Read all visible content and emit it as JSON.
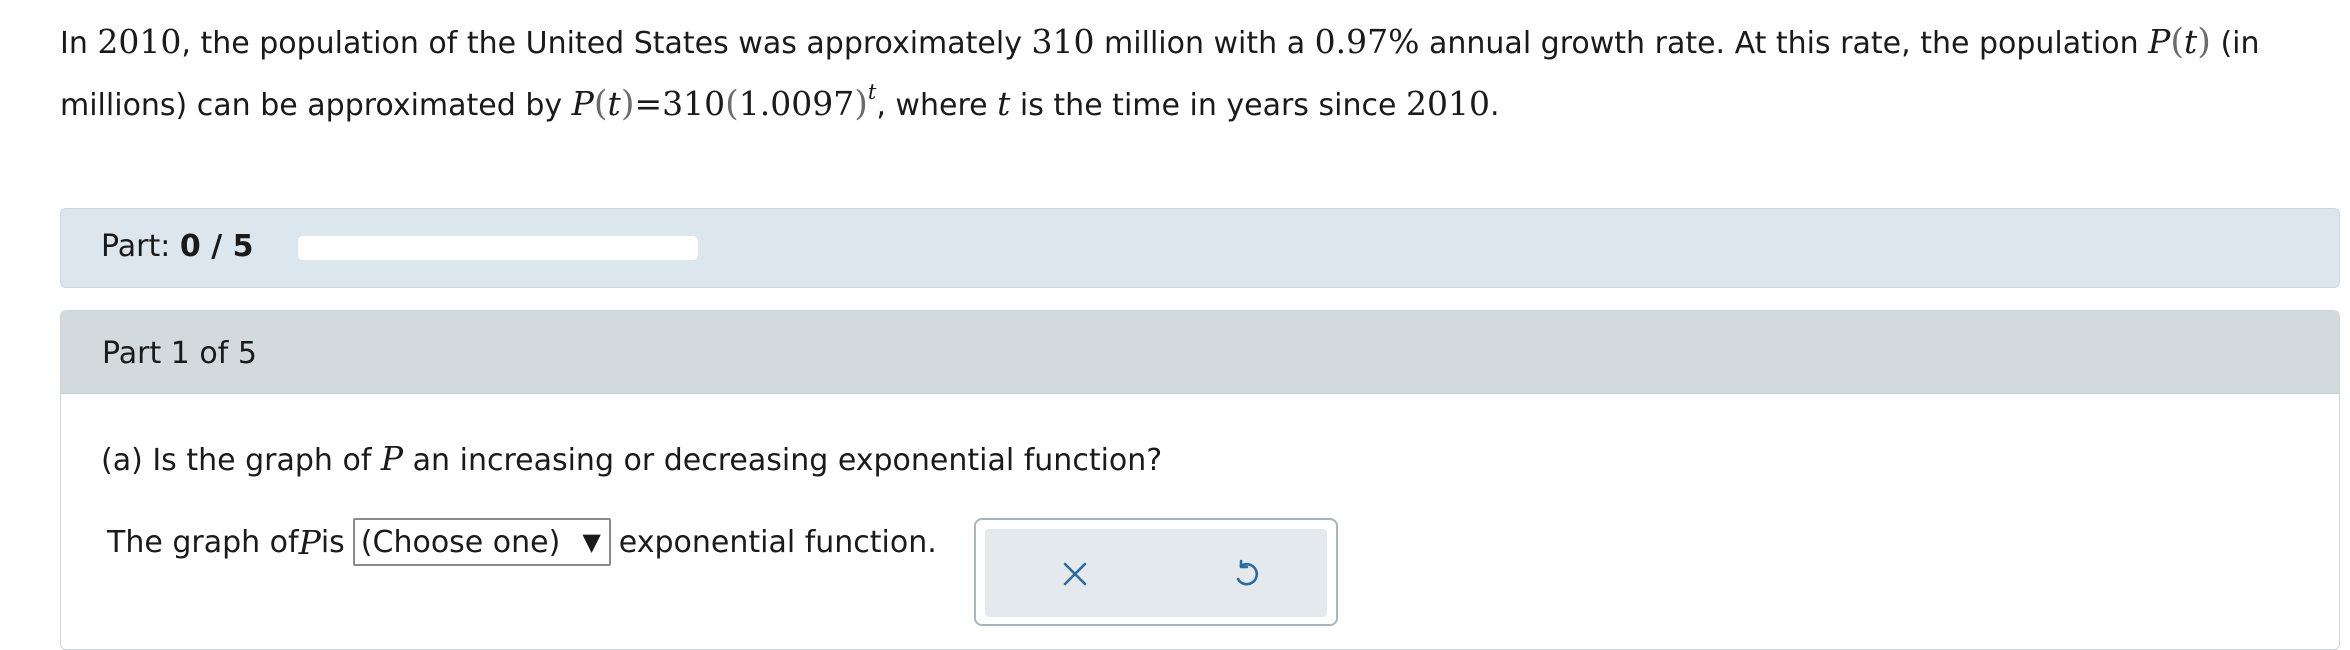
{
  "intro": {
    "s1": "In ",
    "year": "2010",
    "s2": ", the population of the United States was approximately ",
    "pop": "310",
    "s3": " million with a ",
    "rate": "0.97%",
    "s4": " annual growth rate. At this rate, the population ",
    "func_name": "P",
    "paren_open": "(",
    "var": "t",
    "paren_close": ")",
    "s5": " (in millions) can be approximated by ",
    "eq_func": "P",
    "eq_paren_open": "(",
    "eq_var": "t",
    "eq_paren_close": ")",
    "eq_equals": "=",
    "eq_coef": "310",
    "eq_base_open": "(",
    "eq_base": "1.0097",
    "eq_base_close": ")",
    "eq_exp": "t",
    "s6": ", where ",
    "var2": "t",
    "s7": " is the time in years since ",
    "year2": "2010",
    "s8": "."
  },
  "progress": {
    "label": "Part: ",
    "value": "0 / 5",
    "fraction": 0
  },
  "part": {
    "title": "Part 1 of 5",
    "question_prefix": "(a) Is the graph of ",
    "question_var": "P",
    "question_suffix": " an increasing or decreasing exponential function?",
    "answer_prefix": "The graph of ",
    "answer_var": "P",
    "answer_is": " is",
    "select_value": "(Choose one)",
    "select_arrow": "▼",
    "answer_suffix": "exponential function."
  },
  "actions": {
    "clear_icon": "close-icon",
    "undo_icon": "undo-icon",
    "icon_color": "#2d6a9e"
  },
  "colors": {
    "progress_panel": "#dbe6ef",
    "part_header": "#d2dade",
    "action_inner": "#e3e9ed"
  }
}
